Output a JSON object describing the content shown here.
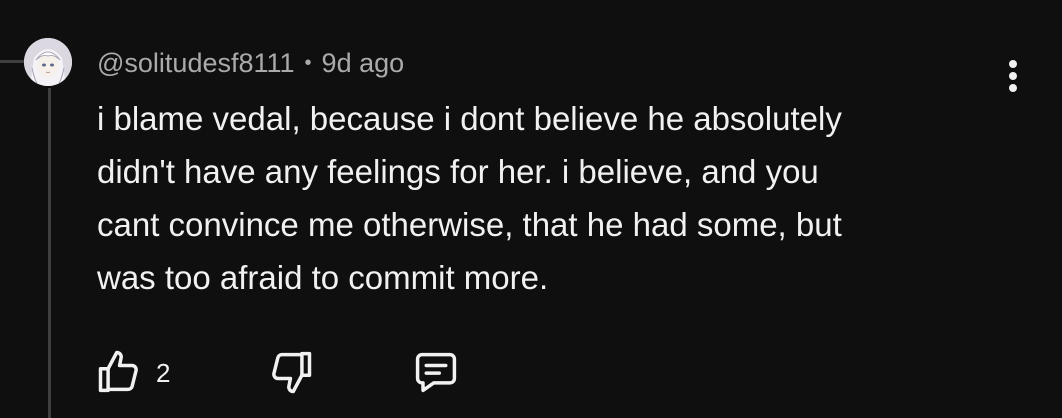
{
  "comment": {
    "author": "@solitudesf8111",
    "separator": "•",
    "timestamp": "9d ago",
    "text": "i blame vedal, because i dont believe he absolutely\ndidn't have any feelings for her. i believe, and you\ncant convince me otherwise, that he had some, but\nwas too afraid to commit more.",
    "like_count": "2"
  },
  "icons": {
    "avatar": "anime-character-avatar",
    "menu": "more-vertical-icon",
    "like": "thumbs-up-icon",
    "dislike": "thumbs-down-icon",
    "reply": "reply-comment-icon"
  },
  "colors": {
    "background": "#0f0f0f",
    "text_primary": "#f1f1f1",
    "text_secondary": "#aaaaaa",
    "thread_line": "#3f3f3f"
  }
}
